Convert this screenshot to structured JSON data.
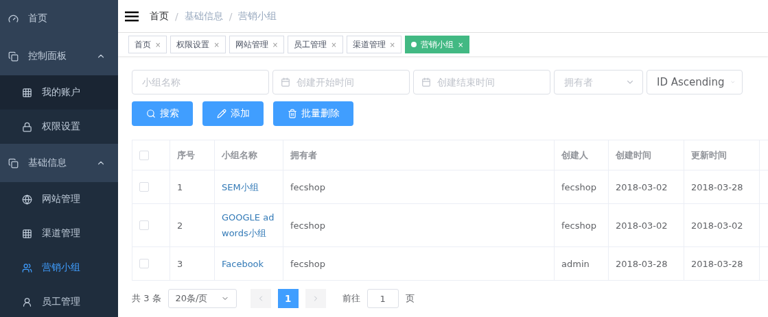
{
  "sidebar": {
    "items": [
      {
        "label": "首页",
        "selected": false
      },
      {
        "label": "控制面板",
        "expanded": true,
        "children": [
          {
            "label": "我的账户",
            "selected": true
          },
          {
            "label": "权限设置",
            "selected": false
          }
        ]
      },
      {
        "label": "基础信息",
        "expanded": true,
        "children": [
          {
            "label": "网站管理",
            "selected": false
          },
          {
            "label": "渠道管理",
            "selected": false
          },
          {
            "label": "营销小组",
            "selected": true
          },
          {
            "label": "员工管理",
            "selected": false
          }
        ]
      }
    ]
  },
  "breadcrumb": [
    {
      "label": "首页"
    },
    {
      "separator": "/",
      "label": "基础信息"
    },
    {
      "separator": "/",
      "label": "营销小组"
    }
  ],
  "tabs": [
    {
      "label": "首页",
      "close": "×",
      "selected": false
    },
    {
      "label": "权限设置",
      "close": "×",
      "selected": false
    },
    {
      "label": "网站管理",
      "close": "×",
      "selected": false
    },
    {
      "label": "员工管理",
      "close": "×",
      "selected": false
    },
    {
      "label": "渠道管理",
      "close": "×",
      "selected": false
    },
    {
      "label": "营销小组",
      "close": "×",
      "selected": true
    }
  ],
  "filters": [
    {
      "kind": "text",
      "placeholder": "小组名称"
    },
    {
      "kind": "date",
      "placeholder": "创建开始时间"
    },
    {
      "kind": "date",
      "placeholder": "创建结束时间"
    },
    {
      "kind": "select",
      "placeholder": "拥有者"
    },
    {
      "kind": "select",
      "value": "ID Ascending"
    }
  ],
  "buttons": [
    {
      "label": "搜索"
    },
    {
      "label": "添加"
    },
    {
      "label": "批量删除"
    }
  ],
  "table": {
    "all_checked": false,
    "columns": [
      "序号",
      "小组名称",
      "拥有者",
      "创建人",
      "创建时间",
      "更新时间"
    ],
    "rows": [
      {
        "checked": false,
        "cells": [
          "1",
          "SEM小组",
          "fecshop",
          "fecshop",
          "2018-03-02",
          "2018-03-28"
        ]
      },
      {
        "checked": false,
        "cells": [
          "2",
          "GOOGLE adwords小组",
          "fecshop",
          "fecshop",
          "2018-03-02",
          "2018-03-02"
        ]
      },
      {
        "checked": false,
        "cells": [
          "3",
          "Facebook",
          "fecshop",
          "admin",
          "2018-03-28",
          "2018-03-28"
        ]
      }
    ]
  },
  "pagination": {
    "total": "共 3 条",
    "page_size": "20条/页",
    "pages": [
      {
        "label": "1",
        "selected": true
      }
    ],
    "goto_label": "前往",
    "goto_value": "1",
    "page_unit": "页"
  }
}
